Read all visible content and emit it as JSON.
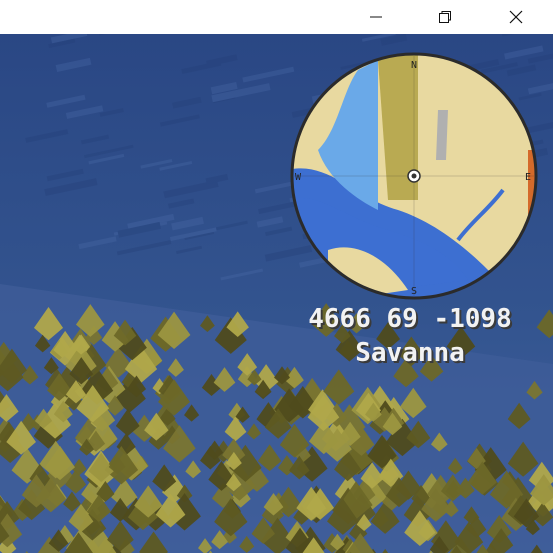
{
  "window": {
    "controls": [
      "minimize",
      "maximize",
      "close"
    ]
  },
  "minimap": {
    "compass": {
      "north": "N",
      "east": "E",
      "south": "S",
      "west": "W"
    },
    "colors": {
      "water": "#3d6fd1",
      "shallow": "#6aa9e8",
      "savanna": "#e8d9a0",
      "grass": "#b9aa52",
      "rim": "#2b2b2b"
    }
  },
  "hud": {
    "coordinates": "4666 69 -1098",
    "biome": "Savanna"
  },
  "scene": {
    "colors": {
      "ocean": "#2f4f8c",
      "ocean_light": "#3d5f9c",
      "grass_dark": "#5e5a22",
      "grass_light": "#9c9640"
    }
  }
}
